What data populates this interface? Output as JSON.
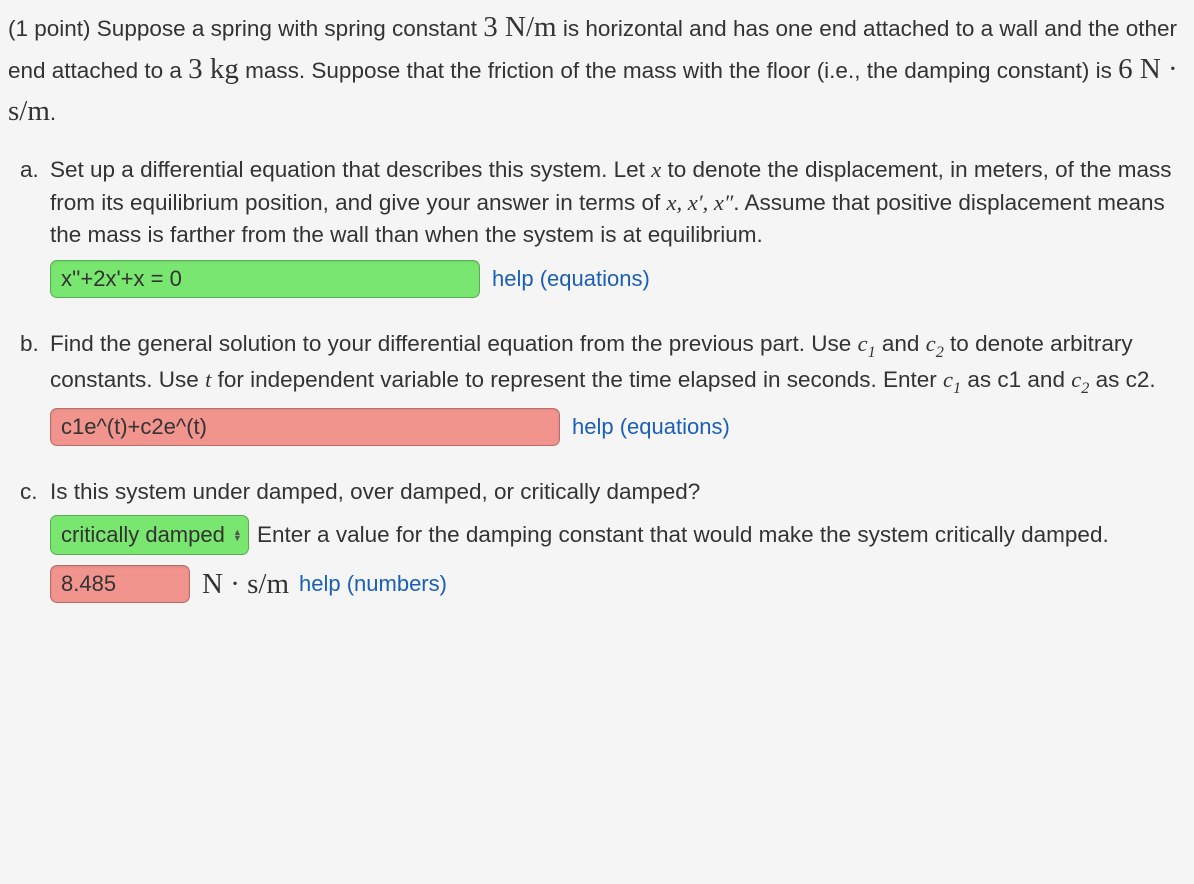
{
  "intro": {
    "points_prefix": "(1 point) ",
    "text1": "Suppose a spring with spring constant ",
    "k_val": "3 ",
    "k_unit": "N/m",
    "text2": " is horizontal and has one end attached to a wall and the other end attached to a ",
    "m_val": "3 ",
    "m_unit": "kg",
    "text3": " mass. Suppose that the friction of the mass with the floor (i.e., the damping constant) is ",
    "c_val": "6 ",
    "c_unit": "N · s/m",
    "period": "."
  },
  "parts": {
    "a": {
      "marker": "a.",
      "t1": "Set up a differential equation that describes this system. Let ",
      "xv": "x",
      "t2": " to denote the displacement, in meters, of the mass from its equilibrium position, and give your answer in terms of ",
      "xlist": "x, x′, x″",
      "t3": ". Assume that positive displacement means the mass is farther from the wall than when the system is at equilibrium.",
      "answer": "x''+2x'+x = 0",
      "help": "help (equations)"
    },
    "b": {
      "marker": "b.",
      "t1": "Find the general solution to your differential equation from the previous part. Use ",
      "c1": "c",
      "c1sub": "1",
      "t2": " and ",
      "c2": "c",
      "c2sub": "2",
      "t3": " to denote arbitrary constants. Use ",
      "tv": "t",
      "t4": " for independent variable to represent the time elapsed in seconds. Enter ",
      "c1b": "c",
      "c1bsub": "1",
      "t5": " as c1 and ",
      "c2b": "c",
      "c2bsub": "2",
      "t6": " as c2.",
      "answer": "c1e^(t)+c2e^(t)",
      "help": "help (equations)"
    },
    "c": {
      "marker": "c.",
      "t1": "Is this system under damped, over damped, or critically damped?",
      "select": "critically damped",
      "t2": " Enter a value for the damping constant that would make the system critically damped.",
      "answer": "8.485",
      "unit": "N · s/m",
      "help": "help (numbers)"
    }
  }
}
